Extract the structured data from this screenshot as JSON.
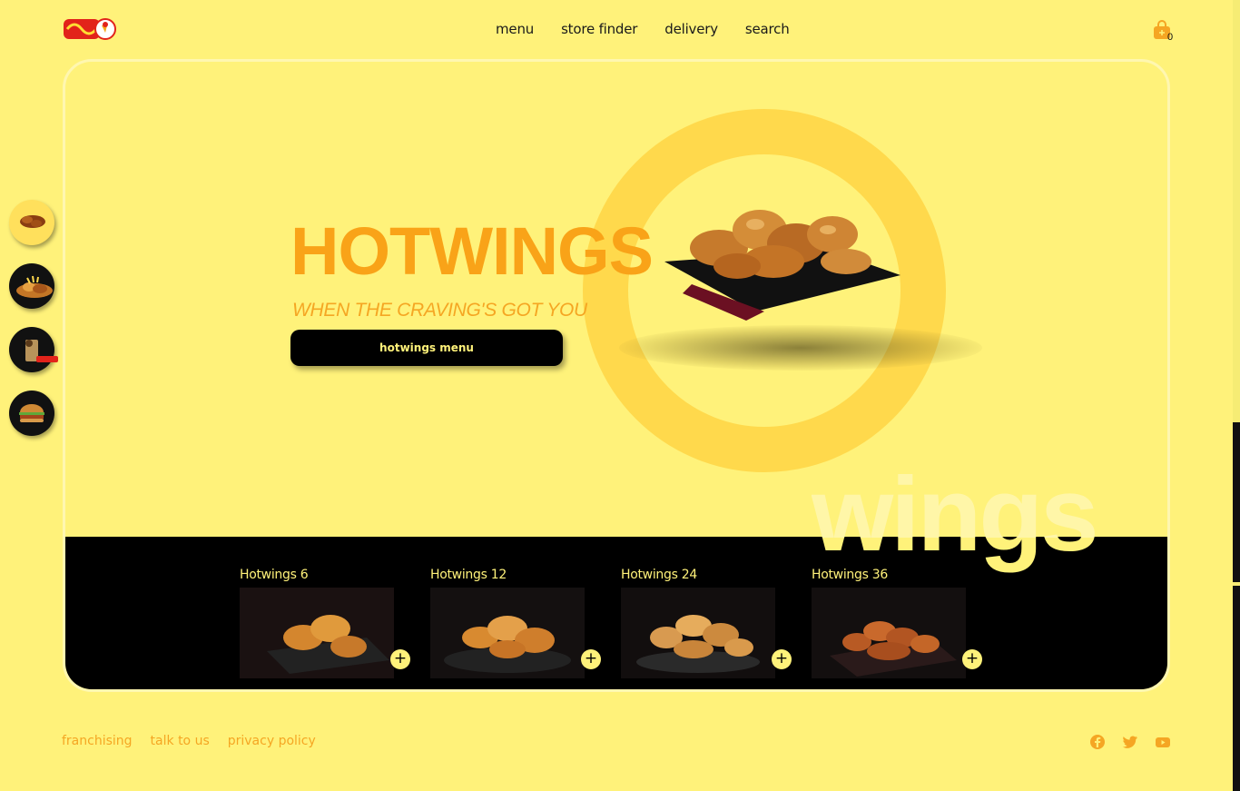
{
  "header": {
    "logo_alt": "Chicken Licken",
    "nav": [
      "menu",
      "store finder",
      "delivery",
      "search"
    ],
    "cart_count": "0"
  },
  "hero": {
    "title": "HOTWINGS",
    "subtitle": "WHEN THE CRAVING'S GOT YOU",
    "button_label": "hotwings menu",
    "background_word": "wings"
  },
  "products": [
    {
      "name": "Hotwings 6",
      "add_label": "+"
    },
    {
      "name": "Hotwings 12",
      "add_label": "+"
    },
    {
      "name": "Hotwings 24",
      "add_label": "+"
    },
    {
      "name": "Hotwings 36",
      "add_label": "+"
    }
  ],
  "side_rail": [
    {
      "icon": "wings-icon",
      "active": true
    },
    {
      "icon": "platter-icon",
      "active": false
    },
    {
      "icon": "drink-icon",
      "active": false
    },
    {
      "icon": "burger-icon",
      "active": false
    }
  ],
  "footer": {
    "links": [
      "franchising",
      "talk to us",
      "privacy policy"
    ],
    "social": [
      "facebook-icon",
      "twitter-icon",
      "youtube-icon"
    ]
  },
  "colors": {
    "background": "#fff27a",
    "accent": "#f9a318",
    "ring": "#ffd94c",
    "dark": "#000000"
  }
}
